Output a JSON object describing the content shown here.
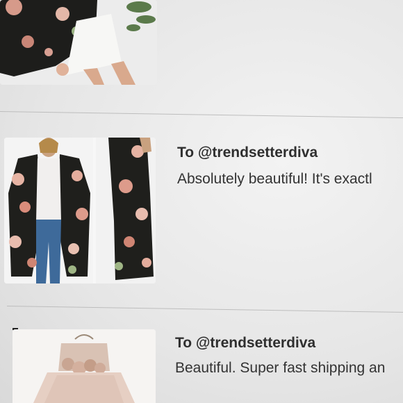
{
  "reviews": [
    {
      "to_label": "",
      "text": ""
    },
    {
      "to_label": "To @trendsetterdiva",
      "text": "Absolutely beautiful! It's exactl"
    },
    {
      "to_label": "To @trendsetterdiva",
      "text": "Beautiful. Super fast shipping an"
    }
  ],
  "colors": {
    "background": "#e9e9e9",
    "divider": "#bdbdbd",
    "text": "#333333"
  }
}
